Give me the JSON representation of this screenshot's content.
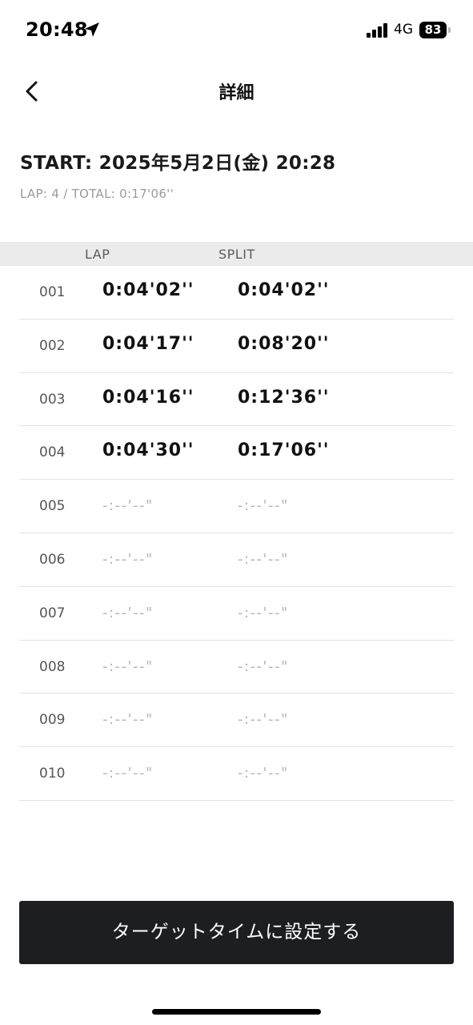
{
  "status_bar": {
    "time": "20:48",
    "network": "4G",
    "battery": "83",
    "icons": [
      "location-arrow-icon",
      "signal-bars-icon",
      "battery-icon"
    ]
  },
  "nav": {
    "title": "詳細",
    "back_icon": "chevron-left-icon"
  },
  "summary": {
    "start": "START: 2025年5月2日(金) 20:28",
    "lap_total": "LAP: 4 / TOTAL: 0:17'06''"
  },
  "table": {
    "header_lap": "LAP",
    "header_split": "SPLIT",
    "rows": [
      {
        "num": "001",
        "lap": "0:04'02''",
        "split": "0:04'02''"
      },
      {
        "num": "002",
        "lap": "0:04'17''",
        "split": "0:08'20''"
      },
      {
        "num": "003",
        "lap": "0:04'16''",
        "split": "0:12'36''"
      },
      {
        "num": "004",
        "lap": "0:04'30''",
        "split": "0:17'06''"
      },
      {
        "num": "005",
        "lap": "-:--'--\"",
        "split": "-:--'--\""
      },
      {
        "num": "006",
        "lap": "-:--'--\"",
        "split": "-:--'--\""
      },
      {
        "num": "007",
        "lap": "-:--'--\"",
        "split": "-:--'--\""
      },
      {
        "num": "008",
        "lap": "-:--'--\"",
        "split": "-:--'--\""
      },
      {
        "num": "009",
        "lap": "-:--'--\"",
        "split": "-:--'--\""
      },
      {
        "num": "010",
        "lap": "-:--'--\"",
        "split": "-:--'--\""
      }
    ]
  },
  "action": {
    "label": "ターゲットタイムに設定する"
  },
  "colors": {
    "button_bg": "#1d1e22",
    "header_bg": "#ebebeb",
    "placeholder_text": "#b6b6b6",
    "secondary_text": "#9a9a9a"
  }
}
